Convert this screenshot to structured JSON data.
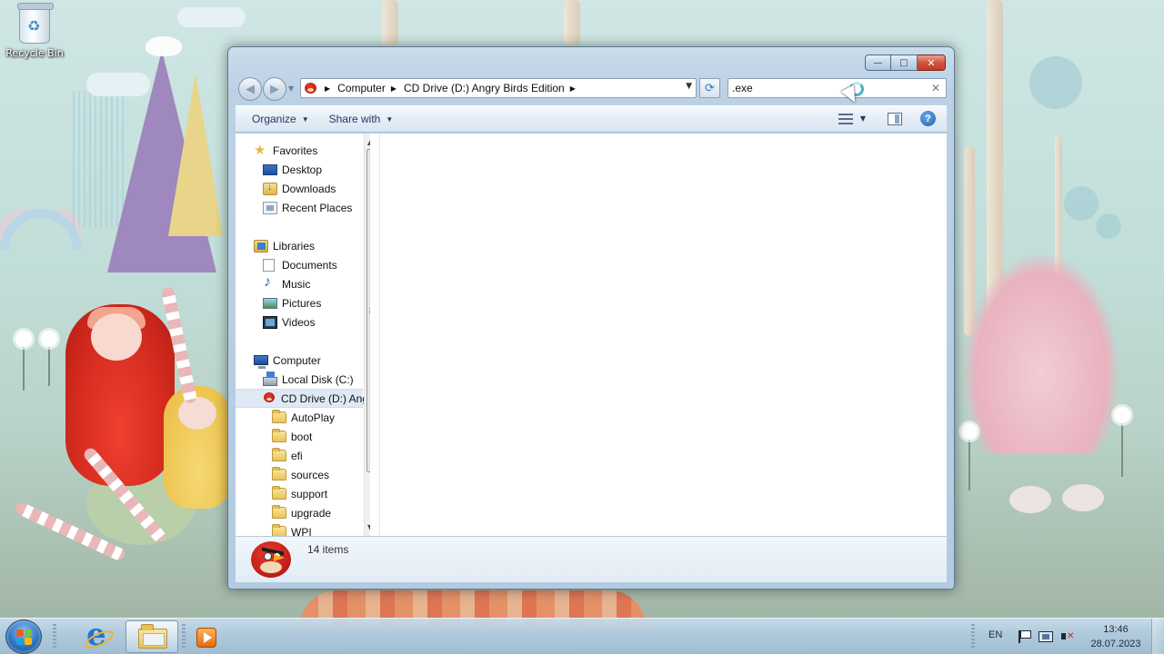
{
  "desktop": {
    "icons": [
      {
        "label": "Recycle Bin",
        "icon": "recycle-bin-icon"
      }
    ]
  },
  "window": {
    "caption_buttons": {
      "minimize": "—",
      "maximize": "□",
      "close": "✕"
    },
    "address_bar": {
      "location_icon": "angry-birds-cd-icon",
      "breadcrumbs": [
        "Computer",
        "CD Drive (D:) Angry Birds Edition"
      ]
    },
    "search": {
      "value": ".exe",
      "clear_icon": "clear-icon"
    },
    "toolbar": {
      "organize_label": "Organize",
      "share_label": "Share with",
      "help_label": "?"
    },
    "nav_pane": {
      "favorites": {
        "label": "Favorites",
        "items": [
          {
            "label": "Desktop"
          },
          {
            "label": "Downloads"
          },
          {
            "label": "Recent Places"
          }
        ]
      },
      "libraries": {
        "label": "Libraries",
        "items": [
          {
            "label": "Documents"
          },
          {
            "label": "Music"
          },
          {
            "label": "Pictures"
          },
          {
            "label": "Videos"
          }
        ]
      },
      "computer": {
        "label": "Computer",
        "items": [
          {
            "label": "Local Disk (C:)"
          },
          {
            "label": "CD Drive (D:) Angry Birds Edition",
            "selected": true
          }
        ],
        "cd_folders": [
          {
            "label": "AutoPlay"
          },
          {
            "label": "boot"
          },
          {
            "label": "efi"
          },
          {
            "label": "sources"
          },
          {
            "label": "support"
          },
          {
            "label": "upgrade"
          },
          {
            "label": "WPI"
          }
        ]
      }
    },
    "details_pane": {
      "item_count": "14 items"
    }
  },
  "taskbar": {
    "pinned": [
      {
        "name": "internet-explorer-icon",
        "active": false
      },
      {
        "name": "windows-explorer-icon",
        "active": true
      },
      {
        "name": "media-player-icon",
        "active": false
      }
    ],
    "tray": {
      "language": "EN",
      "time": "13:46",
      "date": "28.07.2023"
    }
  },
  "colors": {
    "window_frame": "#b3cbe0",
    "toolbar_text": "#1e395b",
    "selection": "#dfe9f5",
    "taskbar": "#b0cbe0"
  }
}
